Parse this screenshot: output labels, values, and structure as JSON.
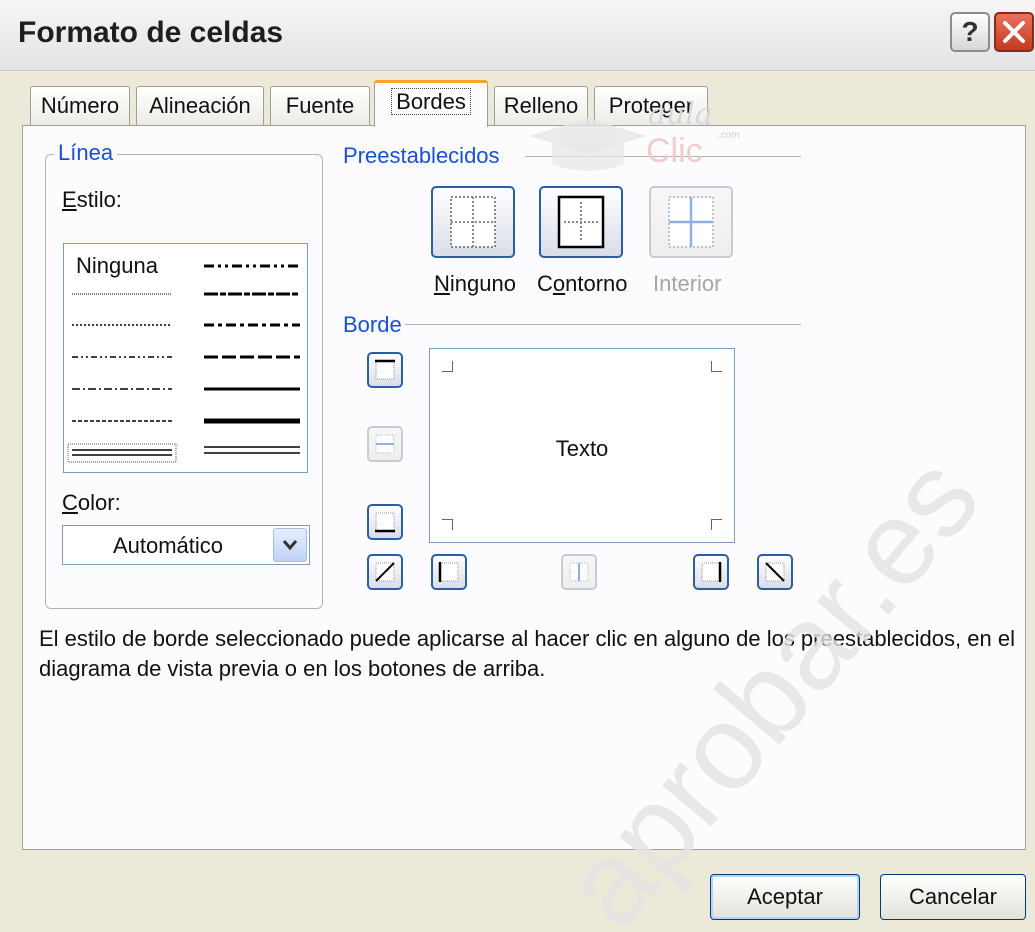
{
  "window": {
    "title": "Formato de celdas",
    "help_label": "?"
  },
  "tabs": [
    {
      "label": "Número"
    },
    {
      "label": "Alineación"
    },
    {
      "label": "Fuente"
    },
    {
      "label": "Bordes",
      "active": true
    },
    {
      "label": "Relleno"
    },
    {
      "label": "Proteger"
    }
  ],
  "linea": {
    "group_label": "Línea",
    "style_label_first": "E",
    "style_label_rest": "stilo:",
    "style_none_label": "Ninguna",
    "color_label_first": "C",
    "color_label_rest": "olor:",
    "color_value": "Automático"
  },
  "presets": {
    "group_label": "Preestablecidos",
    "items": [
      {
        "label_first": "N",
        "label_rest": "inguno",
        "enabled": true
      },
      {
        "label_first": "C",
        "label_mid": "o",
        "label_rest": "ntorno",
        "enabled": true
      },
      {
        "label": "Interior",
        "enabled": false
      }
    ]
  },
  "border": {
    "group_label": "Borde",
    "preview_text": "Texto"
  },
  "description": "El estilo de borde seleccionado puede aplicarse al hacer clic en alguno de los preestablecidos, en el diagrama de vista previa o en los botones de arriba.",
  "buttons": {
    "ok": "Aceptar",
    "cancel": "Cancelar"
  },
  "watermark": {
    "logo_top": "aula",
    "logo_bottom": "Clic",
    "logo_domain": ".com",
    "diagonal": "aprobar.es"
  },
  "colors": {
    "dialog_bg": "#ece9d8",
    "panel_bg": "#fcfcfe",
    "accent_blue": "#1a4fd8",
    "button_border": "#2c5ea8",
    "active_tab_top": "#f5a623",
    "close_red": "#c33a1f"
  },
  "icons": [
    "help-icon",
    "close-icon",
    "dropdown-arrow-icon",
    "preset-none-icon",
    "preset-outline-icon",
    "preset-inside-icon",
    "border-top-icon",
    "border-inside-horizontal-icon",
    "border-bottom-icon",
    "border-diagonal-up-icon",
    "border-left-icon",
    "border-inside-vertical-icon",
    "border-right-icon",
    "border-diagonal-down-icon"
  ]
}
